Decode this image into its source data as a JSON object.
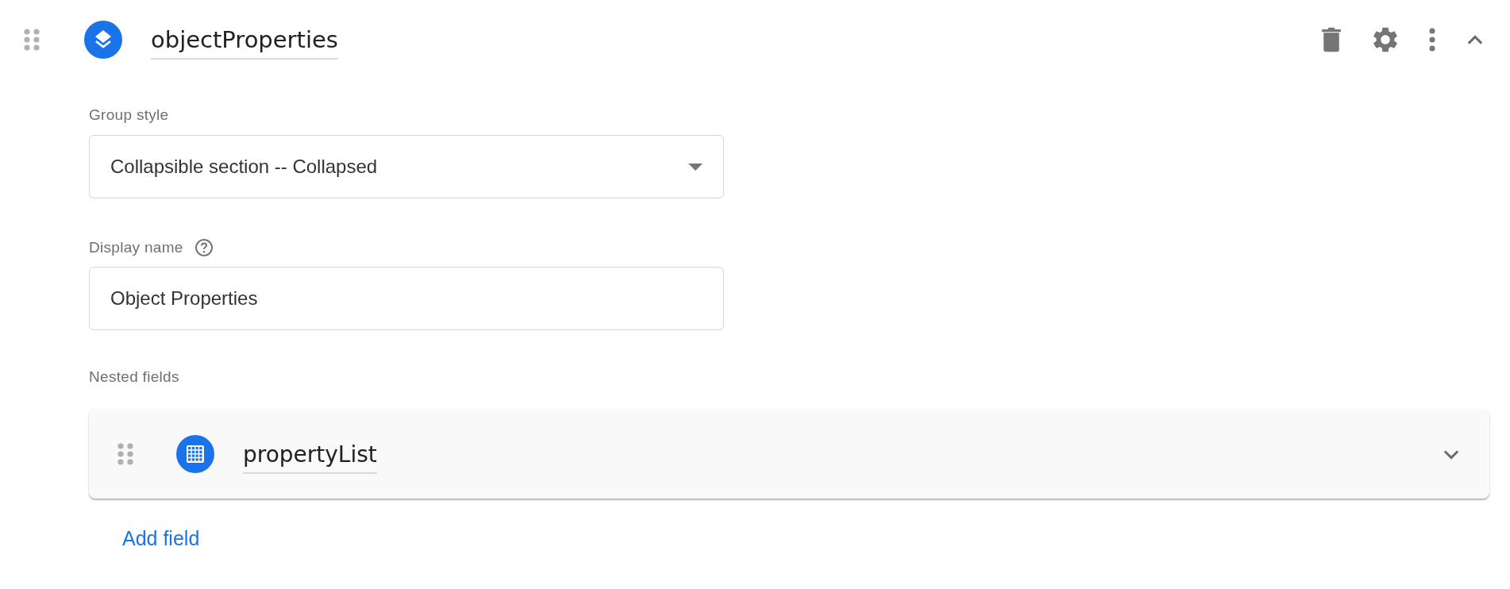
{
  "group": {
    "name": "objectProperties",
    "expanded": true
  },
  "group_style": {
    "label": "Group style",
    "value": "Collapsible section -- Collapsed"
  },
  "display_name": {
    "label": "Display name",
    "value": "Object Properties"
  },
  "nested_fields": {
    "label": "Nested fields",
    "items": [
      {
        "name": "propertyList",
        "expanded": false
      }
    ]
  },
  "add_field": {
    "label": "Add field"
  }
}
